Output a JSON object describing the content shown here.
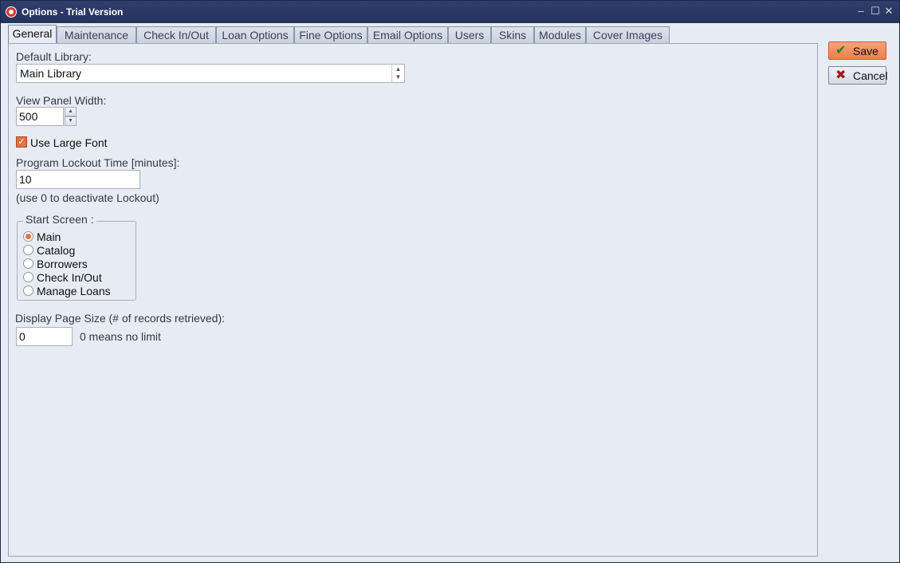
{
  "window": {
    "title": "Options - Trial Version",
    "min_glyph": "–",
    "max_glyph": "☐",
    "close_glyph": "✕"
  },
  "tabs": [
    {
      "label": "General",
      "active": true
    },
    {
      "label": "Maintenance"
    },
    {
      "label": "Check In/Out"
    },
    {
      "label": "Loan Options"
    },
    {
      "label": "Fine Options"
    },
    {
      "label": "Email Options"
    },
    {
      "label": "Users"
    },
    {
      "label": "Skins"
    },
    {
      "label": "Modules"
    },
    {
      "label": "Cover Images"
    }
  ],
  "general": {
    "default_library_label": "Default Library:",
    "default_library_value": "Main Library",
    "view_panel_width_label": "View Panel Width:",
    "view_panel_width_value": "500",
    "large_font_label": "Use Large Font",
    "large_font_checked": true,
    "lockout_label": "Program Lockout Time [minutes]:",
    "lockout_value": "10",
    "lockout_hint": "(use 0 to deactivate Lockout)",
    "start_screen_title": "Start Screen :",
    "start_screen_options": [
      "Main",
      "Catalog",
      "Borrowers",
      "Check In/Out",
      "Manage Loans"
    ],
    "start_screen_selected": "Main",
    "page_size_label": "Display Page Size (# of records retrieved):",
    "page_size_value": "0",
    "page_size_hint": "0 means no limit"
  },
  "actions": {
    "save_label": "Save",
    "cancel_label": "Cancel"
  },
  "colors": {
    "accent": "#e2723f",
    "titlebar": "#2b3a63",
    "panel": "#e7ebf2"
  }
}
